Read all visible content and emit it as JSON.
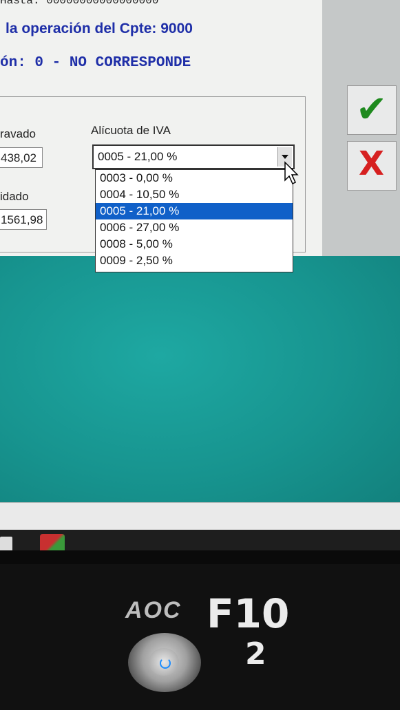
{
  "dialog": {
    "top_partial": "Hasta: 00000000000000000",
    "message_line1": "la operación del Cpte: 9000",
    "message_line2": "ón: 0 - NO CORRESPONDE"
  },
  "form": {
    "gravado_label": "ravado",
    "gravado_value": "438,02",
    "liquidado_label": "idado",
    "liquidado_value": "1561,98",
    "iva_label": "Alícuota de IVA",
    "iva_selected": "0005 - 21,00 %",
    "iva_options": [
      "0003 - 0,00 %",
      "0004 - 10,50 %",
      "0005 - 21,00 %",
      "0006 - 27,00 %",
      "0008 - 5,00 %",
      "0009 - 2,50 %"
    ],
    "iva_highlighted_index": 2
  },
  "buttons": {
    "ok_icon": "checkmark-icon",
    "ok_glyph": "✔",
    "ok_color": "#1e8a1e",
    "cancel_icon": "x-icon",
    "cancel_glyph": "X",
    "cancel_color": "#d62020"
  },
  "monitor": {
    "brand": "AOC",
    "sticker_line1": "F10",
    "sticker_line2": "2"
  },
  "colors": {
    "desktop_teal": "#16938f",
    "message_blue": "#1f2fa8",
    "selection_blue": "#1060c8"
  }
}
